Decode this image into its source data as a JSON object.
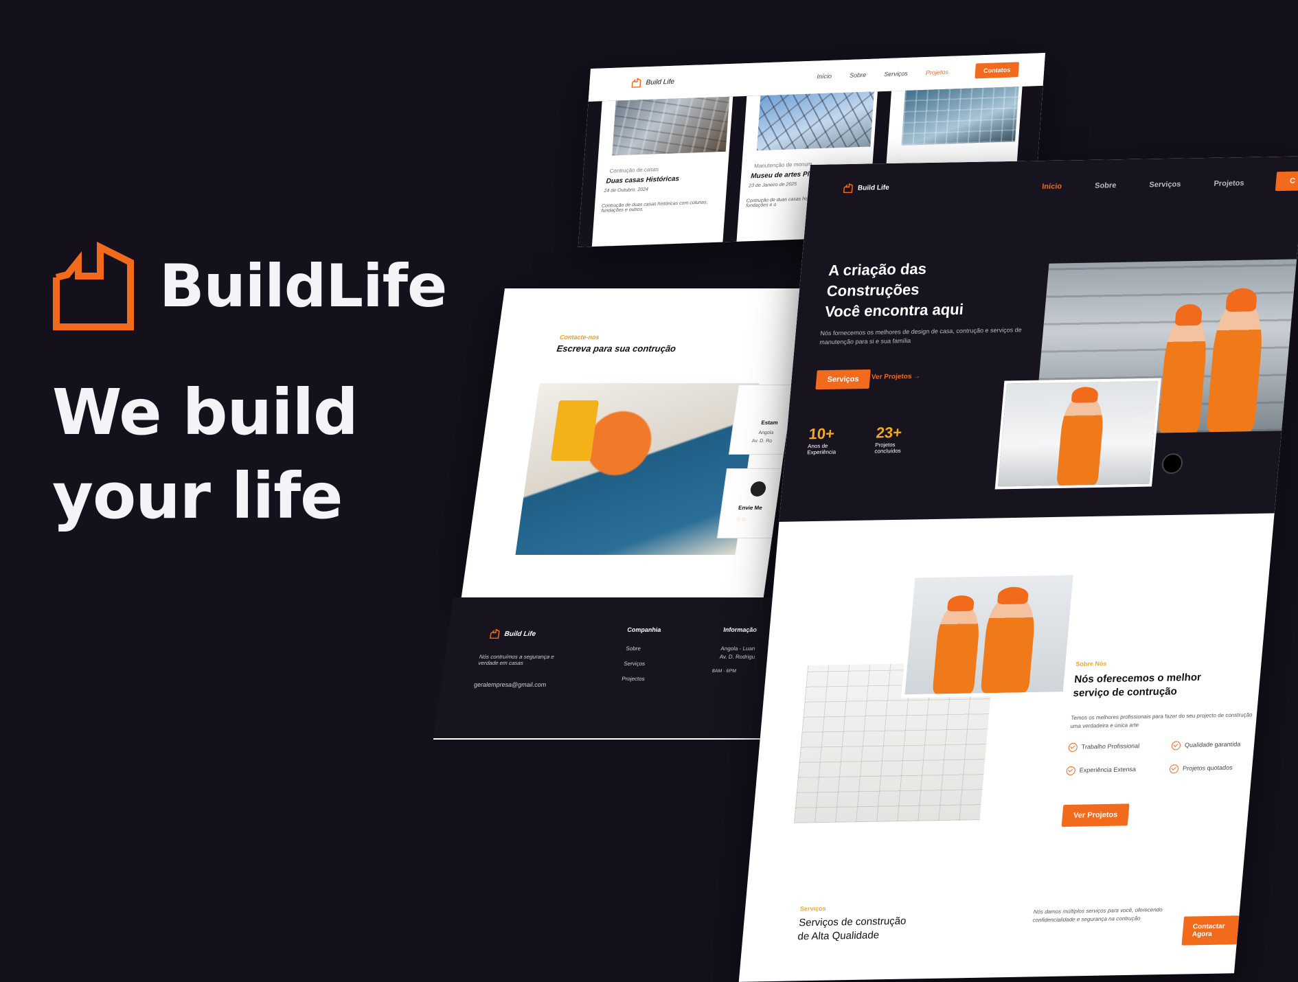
{
  "brand": {
    "name": "BuildLife",
    "tagline_line1": "We build",
    "tagline_line2": "your life",
    "accent": "#f26a1b",
    "background": "#14101c"
  },
  "mock_projects": {
    "logo": "Build Life",
    "nav": [
      "Início",
      "Sobre",
      "Serviços",
      "Projetos"
    ],
    "cta": "Contatos",
    "cards": [
      {
        "category": "Contrução de casas",
        "title": "Duas casas Históricas",
        "date": "24 de Outubro, 2024",
        "desc": "Contrução de duas casas históricas com colunas, fundações e outros."
      },
      {
        "category": "Manutenção de monum",
        "title": "Museu de artes Plás",
        "date": "23 de Janeiro de 2025",
        "desc": "Contrução de duas casas histórica com colunas, fundações e o"
      }
    ]
  },
  "mock_contact": {
    "eyebrow": "Contacte-nos",
    "title": "Escreva para sua contrução",
    "card1_title": "Estam",
    "card1_line1": "Angola",
    "card1_line2": "Av. D. Ro",
    "card2_title": "Envie Me"
  },
  "mock_footer": {
    "logo": "Build Life",
    "about": "Nós contruímos a segurança e verdade em casas",
    "email": "geralempresa@gmail.com",
    "col1_title": "Companhia",
    "col1_items": [
      "Sobre",
      "Serviços",
      "Projectos"
    ],
    "col2_title": "Informação",
    "col2_line1": "Angola - Luan",
    "col2_line2": "Av. D. Rodrigu",
    "col2_line3": "8AM - 6PM"
  },
  "mock_hero": {
    "logo": "Build Life",
    "nav": [
      "Início",
      "Sobre",
      "Serviços",
      "Projetos"
    ],
    "cta": "C",
    "headline1": "A criação das",
    "headline2": "Construções",
    "headline3": "Você encontra aqui",
    "subtitle": "Nós fornecemos os melhores de design de casa, contrução e serviços de manutenção para si e sua família",
    "primary_btn": "Serviços",
    "secondary_link": "Ver Projetos",
    "stats": [
      {
        "value": "10+",
        "label1": "Anos de",
        "label2": "Experiência"
      },
      {
        "value": "23+",
        "label1": "Projetos",
        "label2": "concluídos"
      }
    ]
  },
  "mock_about": {
    "eyebrow": "Sobre Nós",
    "title1": "Nós oferecemos o melhor",
    "title2": "serviço de contrução",
    "desc": "Temos os melhores profissionais para fazer do seu projecto de construção uma verdadeira e única arte",
    "features": [
      "Trabalho Profissional",
      "Qualidade garantida",
      "Experiência Extensa",
      "Projetos quotados"
    ],
    "button": "Ver Projetos"
  },
  "mock_services": {
    "eyebrow": "Serviços",
    "title1": "Serviços de construção",
    "title2": "de Alta Qualidade",
    "desc": "Nós damos múltiplos serviços para você, oferecendo confidencialidade e segurança na contrução",
    "button": "Contactar Agora"
  }
}
